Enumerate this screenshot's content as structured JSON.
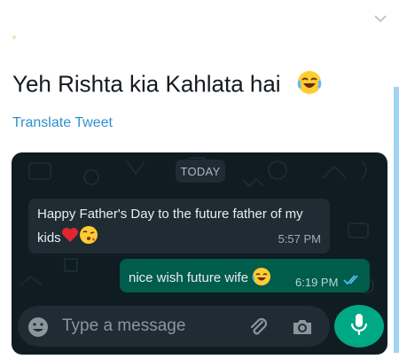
{
  "tweet": {
    "text": "Yeh Rishta kia Kahlata hai",
    "emoji_icon": "laughing-face-icon",
    "translate_label": "Translate Tweet"
  },
  "chat": {
    "date_label": "TODAY",
    "messages": [
      {
        "direction": "incoming",
        "text": "Happy Father's Day to the future father of my kids",
        "emoji_icons": [
          "red-heart-icon",
          "kissing-face-icon"
        ],
        "time": "5:57 PM"
      },
      {
        "direction": "outgoing",
        "text": "nice wish future wife",
        "emoji_icons": [
          "laughing-face-icon"
        ],
        "time": "6:19 PM",
        "status_icon": "double-check-read-icon"
      }
    ],
    "input": {
      "placeholder": "Type a message"
    }
  },
  "colors": {
    "chat_background": "#0f1c22",
    "incoming_bubble": "#1f2c34",
    "outgoing_bubble": "#005c4b",
    "accent_green": "#00a884",
    "link_blue": "#2f8fd0"
  }
}
